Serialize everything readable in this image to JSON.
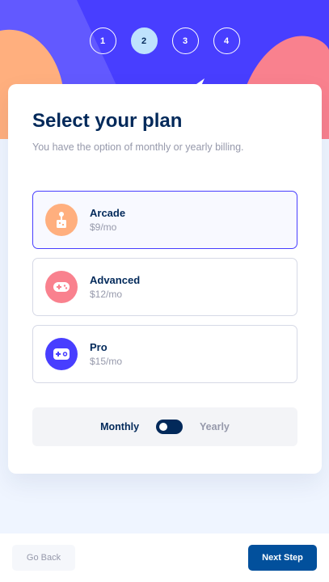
{
  "steps": [
    "1",
    "2",
    "3",
    "4"
  ],
  "active_step": "2",
  "header": {
    "title": "Select your plan",
    "subtitle": "You have the option of monthly or yearly billing."
  },
  "plans": [
    {
      "name": "Arcade",
      "price": "$9/mo",
      "icon": "arcade-icon",
      "color": "#ffaf7e",
      "selected": true
    },
    {
      "name": "Advanced",
      "price": "$12/mo",
      "icon": "gamepad-icon",
      "color": "#f9818e",
      "selected": false
    },
    {
      "name": "Pro",
      "price": "$15/mo",
      "icon": "controller-icon",
      "color": "#483eff",
      "selected": false
    }
  ],
  "billing": {
    "monthly": "Monthly",
    "yearly": "Yearly",
    "selected": "Monthly"
  },
  "footer": {
    "back": "Go Back",
    "next": "Next Step"
  },
  "colors": {
    "marine_blue": "#02295a",
    "purplish_blue": "#483eff",
    "light_blue": "#bee2fd",
    "cool_gray": "#9699ab",
    "button_blue": "#02509c"
  }
}
